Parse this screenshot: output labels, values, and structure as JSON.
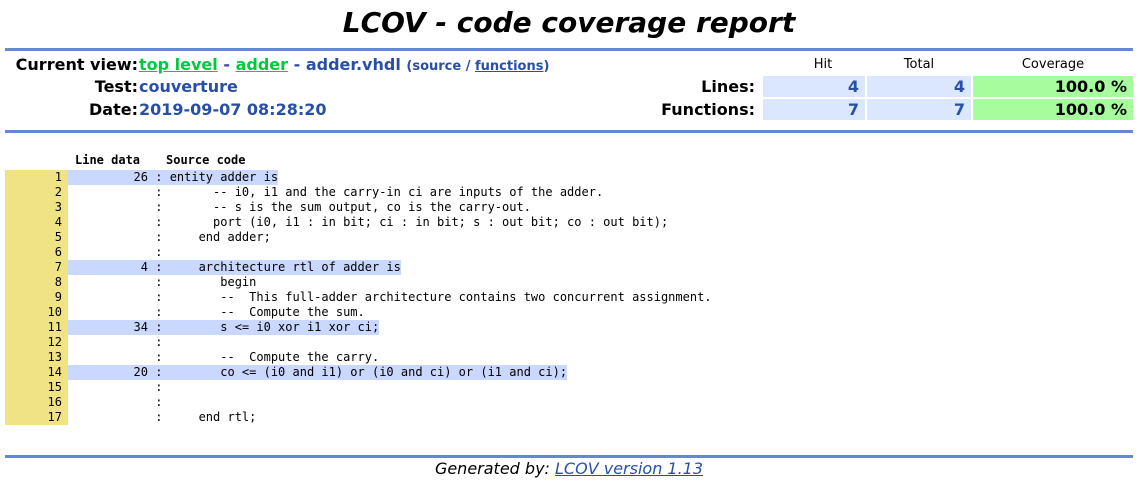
{
  "title": "LCOV - code coverage report",
  "header": {
    "current_view_label": "Current view:",
    "nav": {
      "top_level": "top level",
      "separator": "-",
      "adder": "adder",
      "file": "adder.vhdl",
      "source_label": "source",
      "slash": "/",
      "functions_label": "functions"
    },
    "test_label": "Test:",
    "test_value": "couverture",
    "date_label": "Date:",
    "date_value": "2019-09-07 08:28:20"
  },
  "stats": {
    "col_hit": "Hit",
    "col_total": "Total",
    "col_coverage": "Coverage",
    "lines_label": "Lines:",
    "lines_hit": "4",
    "lines_total": "4",
    "lines_coverage": "100.0 %",
    "functions_label": "Functions:",
    "functions_hit": "7",
    "functions_total": "7",
    "functions_coverage": "100.0 %"
  },
  "source": {
    "col_line_data": "Line data",
    "col_source_code": "Source code",
    "lines": [
      {
        "no": "1",
        "count": "26",
        "hit": true,
        "code": "entity adder is"
      },
      {
        "no": "2",
        "count": "",
        "hit": false,
        "code": "      -- i0, i1 and the carry-in ci are inputs of the adder."
      },
      {
        "no": "3",
        "count": "",
        "hit": false,
        "code": "      -- s is the sum output, co is the carry-out."
      },
      {
        "no": "4",
        "count": "",
        "hit": false,
        "code": "      port (i0, i1 : in bit; ci : in bit; s : out bit; co : out bit);"
      },
      {
        "no": "5",
        "count": "",
        "hit": false,
        "code": "    end adder;"
      },
      {
        "no": "6",
        "count": "",
        "hit": false,
        "code": ""
      },
      {
        "no": "7",
        "count": "4",
        "hit": true,
        "code": "    architecture rtl of adder is"
      },
      {
        "no": "8",
        "count": "",
        "hit": false,
        "code": "       begin"
      },
      {
        "no": "9",
        "count": "",
        "hit": false,
        "code": "       --  This full-adder architecture contains two concurrent assignment."
      },
      {
        "no": "10",
        "count": "",
        "hit": false,
        "code": "       --  Compute the sum."
      },
      {
        "no": "11",
        "count": "34",
        "hit": true,
        "code": "       s <= i0 xor i1 xor ci;"
      },
      {
        "no": "12",
        "count": "",
        "hit": false,
        "code": ""
      },
      {
        "no": "13",
        "count": "",
        "hit": false,
        "code": "       --  Compute the carry."
      },
      {
        "no": "14",
        "count": "20",
        "hit": true,
        "code": "       co <= (i0 and i1) or (i0 and ci) or (i1 and ci);"
      },
      {
        "no": "15",
        "count": "",
        "hit": false,
        "code": ""
      },
      {
        "no": "16",
        "count": "",
        "hit": false,
        "code": ""
      },
      {
        "no": "17",
        "count": "",
        "hit": false,
        "code": "    end rtl;"
      }
    ]
  },
  "footer": {
    "generated_by": "Generated by:",
    "lcov_link": "LCOV version 1.13"
  },
  "colors": {
    "ruler": "#6688d4",
    "link_green": "#00cb40",
    "value_blue": "#284fa8",
    "hit_bg": "#cad7fe",
    "lineno_bg": "#efe383",
    "stat_num_bg": "#dae7fe",
    "stat_pct_bg": "#a7fc9d"
  }
}
